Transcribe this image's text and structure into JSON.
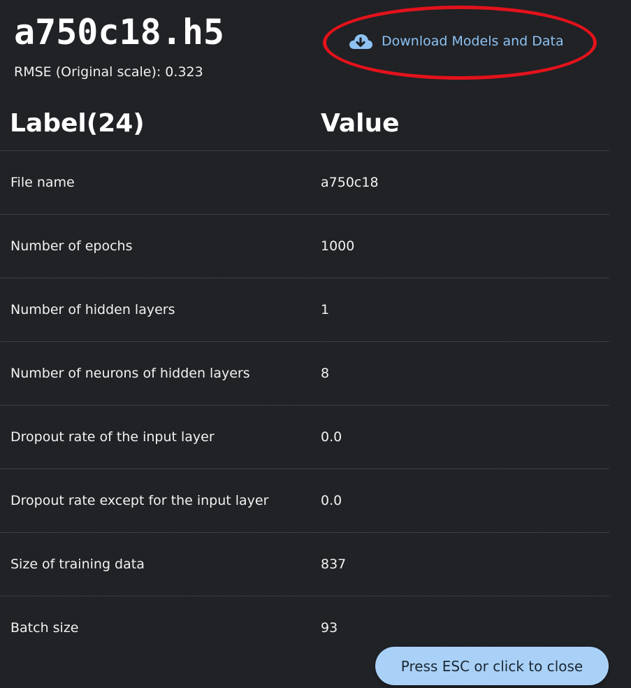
{
  "header": {
    "title": "a750c18.h5",
    "rmse_text": "RMSE (Original scale): 0.323"
  },
  "download": {
    "label": "Download Models and Data",
    "icon": "cloud-download-icon",
    "accent_color": "#8ec2f2",
    "highlight_color": "#e3121b"
  },
  "table": {
    "columns": [
      "Label(24)",
      "Value"
    ],
    "rows": [
      {
        "label": "File name",
        "value": "a750c18"
      },
      {
        "label": "Number of epochs",
        "value": "1000"
      },
      {
        "label": "Number of hidden layers",
        "value": "1"
      },
      {
        "label": "Number of neurons of hidden layers",
        "value": "8"
      },
      {
        "label": "Dropout rate of the input layer",
        "value": "0.0"
      },
      {
        "label": "Dropout rate except for the input layer",
        "value": "0.0"
      },
      {
        "label": "Size of training data",
        "value": "837"
      },
      {
        "label": "Batch size",
        "value": "93"
      }
    ]
  },
  "close_button": {
    "label": "Press ESC or click to close",
    "color": "#a9d1f7"
  },
  "colors": {
    "background": "#1f2125",
    "text": "#f2f2f2"
  }
}
